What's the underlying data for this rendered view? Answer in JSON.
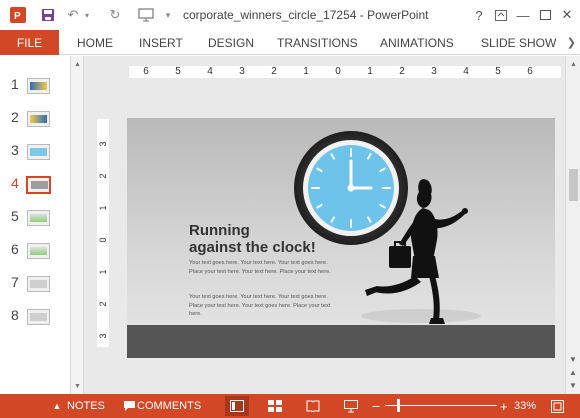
{
  "window": {
    "title": "corporate_winners_circle_17254 - PowerPoint",
    "help": "?"
  },
  "ribbon": {
    "file": "FILE",
    "tabs": [
      "HOME",
      "INSERT",
      "DESIGN",
      "TRANSITIONS",
      "ANIMATIONS",
      "SLIDE SHOW"
    ]
  },
  "thumbnails": {
    "numbers": [
      "1",
      "2",
      "3",
      "4",
      "5",
      "6",
      "7",
      "8"
    ],
    "active_index": 4
  },
  "ruler": {
    "horizontal": [
      "6",
      "5",
      "4",
      "3",
      "2",
      "1",
      "0",
      "1",
      "2",
      "3",
      "4",
      "5",
      "6"
    ],
    "vertical": [
      "3",
      "2",
      "1",
      "0",
      "1",
      "2",
      "3"
    ]
  },
  "slide": {
    "title_line1": "Running",
    "title_line2": "against the clock!",
    "para1": "Your text goes here. Your text here. Your text goes here. Place your text here. Your text here. Place your text here.",
    "para2": "Your text goes here. Your text here. Your text goes here. Place your text here. Your text goes here. Place your text here."
  },
  "statusbar": {
    "notes": "NOTES",
    "comments": "COMMENTS",
    "zoom": "33%",
    "zoom_fraction": 0.33
  },
  "colors": {
    "accent": "#d24726",
    "clock_face": "#6ec3ea",
    "floor": "#555555"
  }
}
